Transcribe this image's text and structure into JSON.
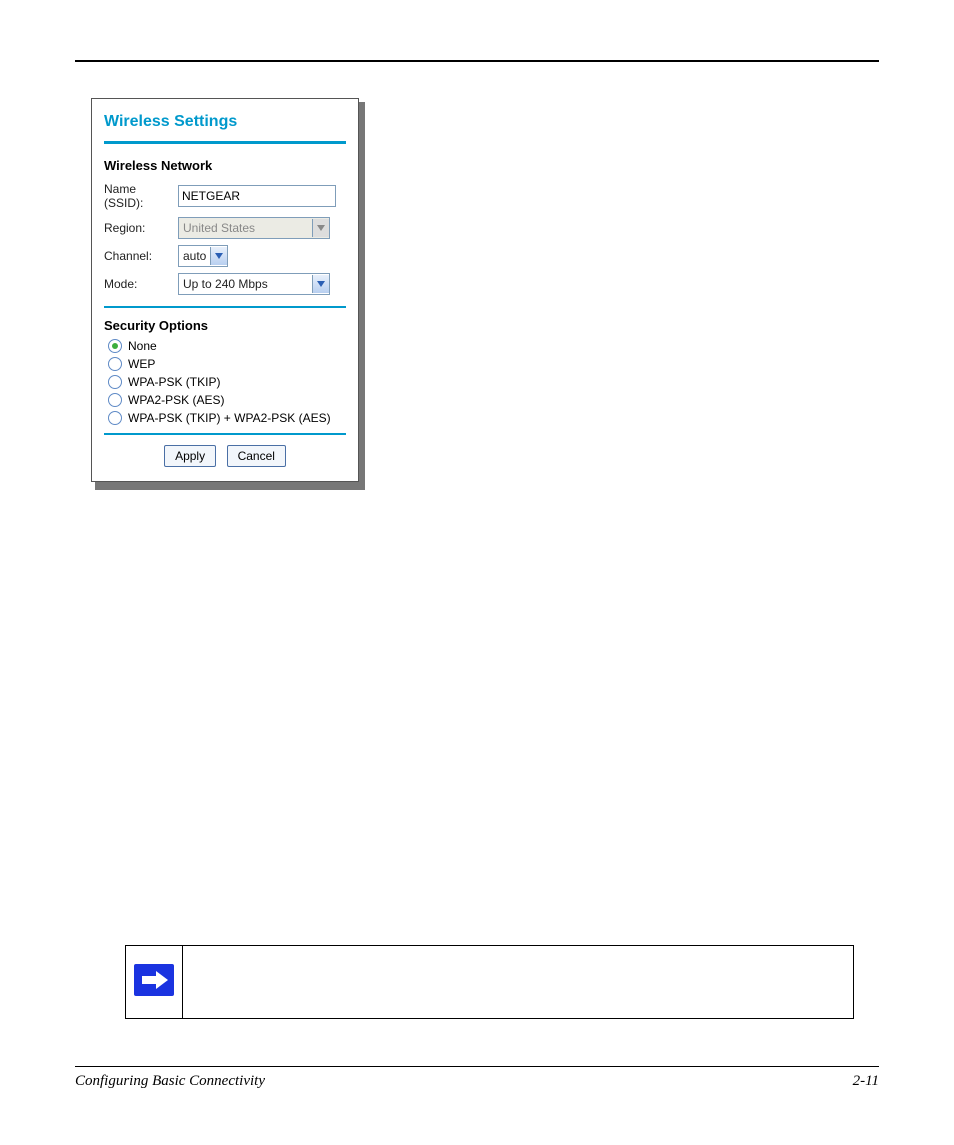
{
  "panel": {
    "title": "Wireless Settings",
    "network_section_label": "Wireless Network",
    "name_label": "Name (SSID):",
    "name_value": "NETGEAR",
    "region_label": "Region:",
    "region_value": "United States",
    "channel_label": "Channel:",
    "channel_value": "auto",
    "mode_label": "Mode:",
    "mode_value": "Up to 240 Mbps",
    "security_section_label": "Security Options",
    "options": {
      "opt0": "None",
      "opt1": "WEP",
      "opt2": "WPA-PSK (TKIP)",
      "opt3": "WPA2-PSK (AES)",
      "opt4": "WPA-PSK (TKIP) + WPA2-PSK (AES)"
    },
    "apply_label": "Apply",
    "cancel_label": "Cancel"
  },
  "footer": {
    "left": "Configuring Basic Connectivity",
    "right": "2-11"
  }
}
